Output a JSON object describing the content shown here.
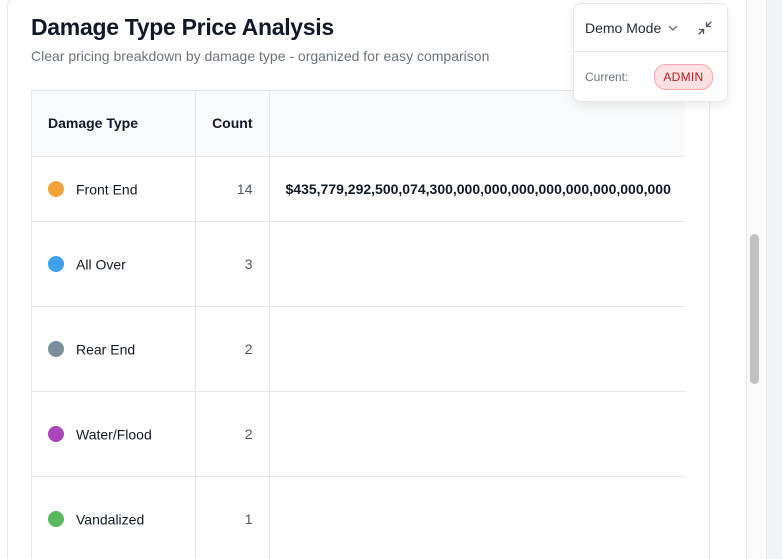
{
  "header": {
    "title": "Damage Type Price Analysis",
    "subtitle": "Clear pricing breakdown by damage type - organized for easy comparison"
  },
  "table": {
    "columns": [
      "Damage Type",
      "Count",
      ""
    ],
    "rows": [
      {
        "type": "Front End",
        "color": "#f6a23c",
        "count": "14",
        "price": "$435,779,292,500,074,300,000,000,000,000,000,000,000,000"
      },
      {
        "type": "All Over",
        "color": "#3ea2f0",
        "count": "3",
        "price": ""
      },
      {
        "type": "Rear End",
        "color": "#78909c",
        "count": "2",
        "price": ""
      },
      {
        "type": "Water/Flood",
        "color": "#ab47bc",
        "count": "2",
        "price": ""
      },
      {
        "type": "Vandalized",
        "color": "#5cb85f",
        "count": "1",
        "price": ""
      }
    ]
  },
  "demo_panel": {
    "mode_label": "Demo Mode",
    "current_label": "Current:",
    "role": "ADMIN",
    "chevron_icon": "chevron-down-icon",
    "collapse_icon": "collapse-icon"
  }
}
